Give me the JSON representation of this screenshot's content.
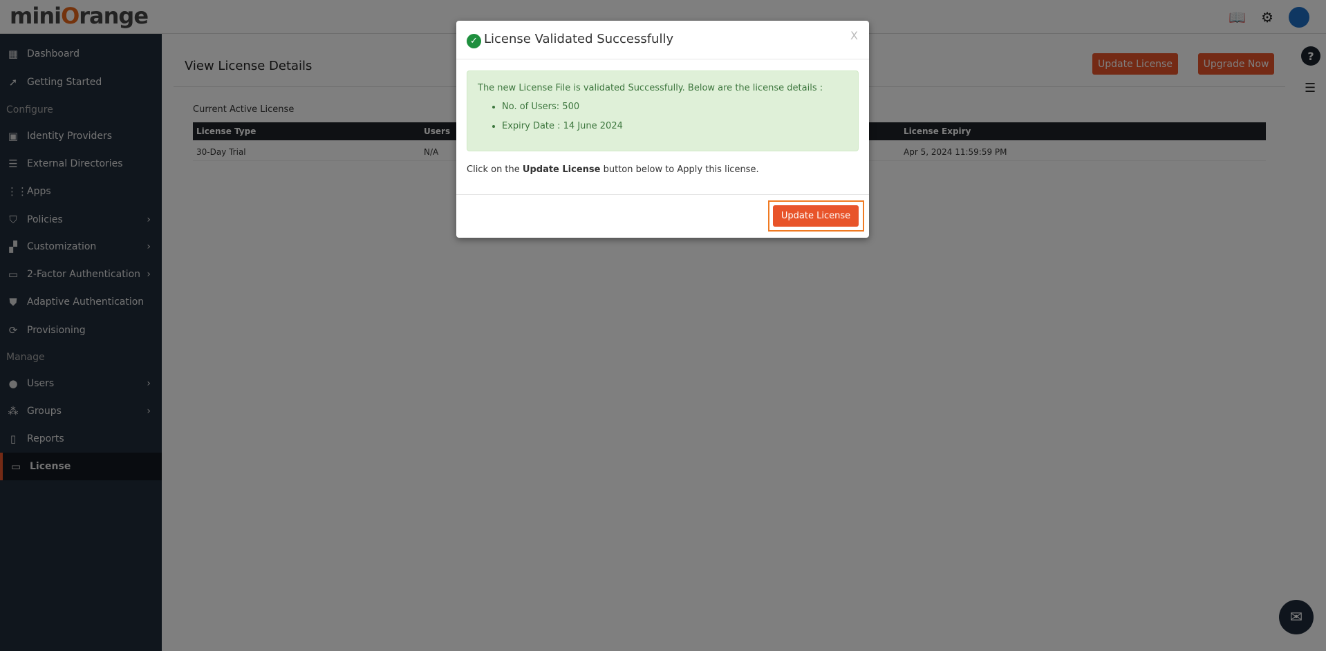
{
  "header": {
    "logo": "miniOrange",
    "icons": [
      "book-icon",
      "gear-icon",
      "avatar"
    ]
  },
  "sidebar": {
    "items": [
      {
        "label": "Dashboard",
        "icon": "dashboard-icon",
        "glyph": "▦"
      },
      {
        "label": "Getting Started",
        "icon": "rocket-icon",
        "glyph": "➚"
      },
      {
        "label": "Identity Providers",
        "icon": "id-card-icon",
        "glyph": "▣"
      },
      {
        "label": "External Directories",
        "icon": "directory-icon",
        "glyph": "☰"
      },
      {
        "label": "Apps",
        "icon": "apps-grid-icon",
        "glyph": "⋮⋮"
      },
      {
        "label": "Policies",
        "icon": "policy-shield-icon",
        "glyph": "⛉",
        "chevron": true
      },
      {
        "label": "Customization",
        "icon": "customization-icon",
        "glyph": "▞",
        "chevron": true
      },
      {
        "label": "2-Factor Authentication",
        "icon": "2fa-icon",
        "glyph": "▭",
        "chevron": true
      },
      {
        "label": "Adaptive Authentication",
        "icon": "shield-check-icon",
        "glyph": "⛊"
      },
      {
        "label": "Provisioning",
        "icon": "sync-icon",
        "glyph": "⟳"
      },
      {
        "label": "Users",
        "icon": "user-icon",
        "glyph": "●",
        "chevron": true
      },
      {
        "label": "Groups",
        "icon": "groups-icon",
        "glyph": "⁂",
        "chevron": true
      },
      {
        "label": "Reports",
        "icon": "clipboard-icon",
        "glyph": "▯"
      },
      {
        "label": "License",
        "icon": "card-icon",
        "glyph": "▭",
        "active": true
      }
    ],
    "sections": {
      "configure": "Configure",
      "manage": "Manage"
    }
  },
  "main": {
    "title": "View License Details",
    "update_license": "Update License",
    "upgrade_now": "Upgrade Now",
    "current_label": "Current Active License",
    "columns": {
      "type": "License Type",
      "users": "Users",
      "expiry": "License Expiry"
    },
    "row": {
      "type": "30-Day Trial",
      "users": "N/A",
      "expiry": "Apr 5, 2024 11:59:59 PM"
    },
    "help": "?"
  },
  "modal": {
    "title": "License Validated Successfully",
    "close": "X",
    "message": "The new License File is validated Successfully. Below are the license details :",
    "details": [
      "No. of Users: 500",
      "Expiry Date : 14 June 2024"
    ],
    "instruction_pre": "Click on the ",
    "instruction_bold": "Update License",
    "instruction_post": " button below to Apply this license.",
    "button": "Update License"
  },
  "colors": {
    "accent": "#e8542a",
    "sidebar": "#212c3b",
    "success": "#1e8f3e",
    "alert_bg": "#dff0d8"
  }
}
